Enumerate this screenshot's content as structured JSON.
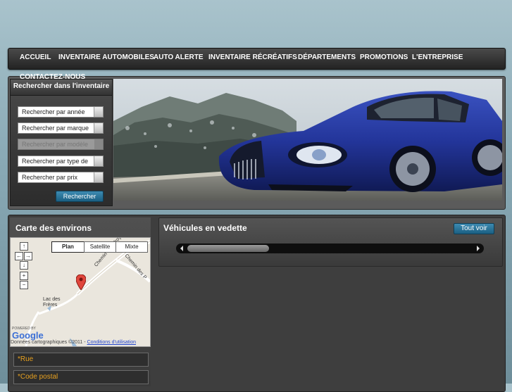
{
  "nav": {
    "items": [
      {
        "label": "ACCUEIL"
      },
      {
        "label": "INVENTAIRE AUTOMOBILES"
      },
      {
        "label": "AUTO ALERTE"
      },
      {
        "label": "INVENTAIRE RÉCRÉATIFS"
      },
      {
        "label": "DÉPARTEMENTS"
      },
      {
        "label": "PROMOTIONS"
      },
      {
        "label": "L'ENTREPRISE"
      }
    ],
    "overflow_label": "CONTACTEZ-NOUS"
  },
  "search": {
    "title": "Rechercher dans l'inventaire",
    "selects": [
      {
        "label": "Rechercher par année"
      },
      {
        "label": "Rechercher par marque"
      },
      {
        "label": "Rechercher par modèle"
      },
      {
        "label": "Rechercher par type de"
      },
      {
        "label": "Rechercher par prix"
      }
    ],
    "submit_label": "Rechercher"
  },
  "map_section": {
    "title": "Carte des environs",
    "map_types": [
      {
        "label": "Plan"
      },
      {
        "label": "Satellite"
      },
      {
        "label": "Mixte"
      }
    ],
    "selected_map_type": "Plan",
    "labels": [
      {
        "text": "Chemin Godefroy"
      },
      {
        "text": "Chemin des P"
      },
      {
        "text": "Lac des"
      },
      {
        "text": "Frères"
      }
    ],
    "powered_by": "POWERED BY",
    "google_logo": "Google",
    "footer_data": "Données cartographiques ©2011",
    "footer_sep": " - ",
    "footer_terms": "Conditions d'utilisation"
  },
  "form": {
    "street_label": "*Rue",
    "postal_label": "*Code postal"
  },
  "featured": {
    "title": "Véhicules en vedette",
    "see_all_label": "Tout voir",
    "scroll_position": 0.0
  },
  "colors": {
    "accent_blue": "#1a5f82",
    "field_label": "#e6a020",
    "car_blue": "#2a3fa0"
  }
}
